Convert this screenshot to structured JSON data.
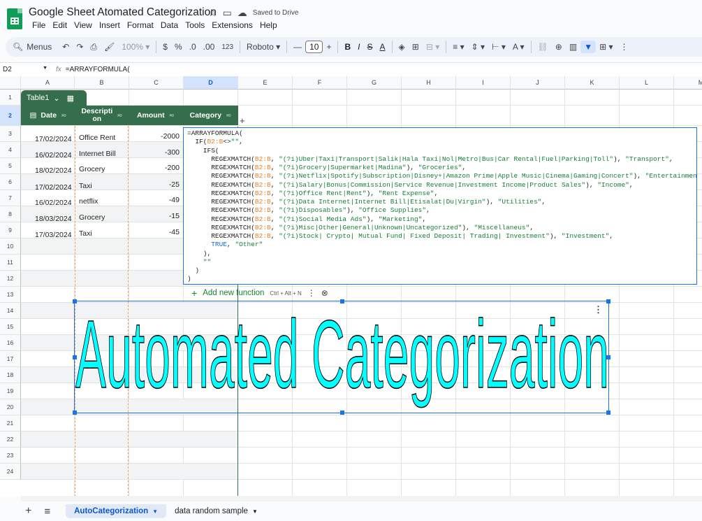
{
  "app": {
    "doc_title": "Google Sheet Atomated Categorization",
    "saved_status": "Saved to Drive",
    "menu": [
      "File",
      "Edit",
      "View",
      "Insert",
      "Format",
      "Data",
      "Tools",
      "Extensions",
      "Help"
    ]
  },
  "toolbar": {
    "menus_label": "Menus",
    "zoom": "100%",
    "currency": "$",
    "percent": "%",
    "dec_decrease": ".0",
    "dec_increase": ".00",
    "more_formats": "123",
    "font": "Roboto",
    "font_size": "10",
    "minus": "—",
    "plus": "+",
    "bold": "B",
    "italic": "I",
    "strike": "S",
    "underline": "A"
  },
  "formula_bar": {
    "cell_ref": "D2",
    "fx": "fx",
    "formula": "=ARRAYFORMULA("
  },
  "columns": [
    "A",
    "B",
    "C",
    "D",
    "E",
    "F",
    "G",
    "H",
    "I",
    "J",
    "K",
    "L",
    "M"
  ],
  "rows": [
    "1",
    "2",
    "3",
    "4",
    "5",
    "6",
    "7",
    "8",
    "9",
    "10",
    "11",
    "12",
    "13",
    "14",
    "15",
    "16",
    "17",
    "18",
    "19",
    "20",
    "21",
    "22",
    "23",
    "24"
  ],
  "table": {
    "name": "Table1",
    "headers": {
      "date": "Date",
      "description_line1": "Descripti",
      "description_line2": "on",
      "amount": "Amount",
      "category": "Category"
    },
    "add_column": "+",
    "rows": [
      {
        "date": "17/02/2024",
        "description": "Office Rent",
        "amount": "-2000"
      },
      {
        "date": "16/02/2024",
        "description": "Internet Bill",
        "amount": "-300"
      },
      {
        "date": "18/02/2024",
        "description": "Grocery",
        "amount": "-200"
      },
      {
        "date": "17/02/2024",
        "description": "Taxi",
        "amount": "-25"
      },
      {
        "date": "16/02/2024",
        "description": "netflix",
        "amount": "-49"
      },
      {
        "date": "18/03/2024",
        "description": "Grocery",
        "amount": "-15"
      },
      {
        "date": "17/03/2024",
        "description": "Taxi",
        "amount": "-45"
      }
    ]
  },
  "editor": {
    "lines": [
      [
        {
          "t": "=ARRAYFORMULA("
        }
      ],
      [
        {
          "t": "  IF("
        },
        {
          "t": "B2:B",
          "c": "ref"
        },
        {
          "t": "<>"
        },
        {
          "t": "\"\"",
          "c": "str"
        },
        {
          "t": ","
        }
      ],
      [
        {
          "t": "    IFS("
        }
      ],
      [
        {
          "t": "      REGEXMATCH("
        },
        {
          "t": "B2:B",
          "c": "ref"
        },
        {
          "t": ", "
        },
        {
          "t": "\"(?i)Uber|Taxi|Transport|Salik|Hala Taxi|Nol|Metro|Bus|Car Rental|Fuel|Parking|Toll\"",
          "c": "str"
        },
        {
          "t": "), "
        },
        {
          "t": "\"Transport\"",
          "c": "str"
        },
        {
          "t": ","
        }
      ],
      [
        {
          "t": "      REGEXMATCH("
        },
        {
          "t": "B2:B",
          "c": "ref"
        },
        {
          "t": ", "
        },
        {
          "t": "\"(?i)Grocery|Supermarket|Madina\"",
          "c": "str"
        },
        {
          "t": "), "
        },
        {
          "t": "\"Groceries\"",
          "c": "str"
        },
        {
          "t": ","
        }
      ],
      [
        {
          "t": "      REGEXMATCH("
        },
        {
          "t": "B2:B",
          "c": "ref"
        },
        {
          "t": ", "
        },
        {
          "t": "\"(?i)Netflix|Spotify|Subscription|Disney+|Amazon Prime|Apple Music|Cinema|Gaming|Concert\"",
          "c": "str"
        },
        {
          "t": "), "
        },
        {
          "t": "\"Entertainment\"",
          "c": "str"
        },
        {
          "t": ","
        }
      ],
      [
        {
          "t": "      REGEXMATCH("
        },
        {
          "t": "B2:B",
          "c": "ref"
        },
        {
          "t": ", "
        },
        {
          "t": "\"(?i)Salary|Bonus|Commission|Service Revenue|Investment Income|Product Sales\"",
          "c": "str"
        },
        {
          "t": "), "
        },
        {
          "t": "\"Income\"",
          "c": "str"
        },
        {
          "t": ","
        }
      ],
      [
        {
          "t": "      REGEXMATCH("
        },
        {
          "t": "B2:B",
          "c": "ref"
        },
        {
          "t": ", "
        },
        {
          "t": "\"(?i)Office Rent|Rent\"",
          "c": "str"
        },
        {
          "t": "), "
        },
        {
          "t": "\"Rent Expense\"",
          "c": "str"
        },
        {
          "t": ","
        }
      ],
      [
        {
          "t": "      REGEXMATCH("
        },
        {
          "t": "B2:B",
          "c": "ref"
        },
        {
          "t": ", "
        },
        {
          "t": "\"(?i)Data Internet|Internet Bill|Etisalat|Du|Virgin\"",
          "c": "str"
        },
        {
          "t": "), "
        },
        {
          "t": "\"Utilities\"",
          "c": "str"
        },
        {
          "t": ","
        }
      ],
      [
        {
          "t": "      REGEXMATCH("
        },
        {
          "t": "B2:B",
          "c": "ref"
        },
        {
          "t": ", "
        },
        {
          "t": "\"(?i)Disposables\"",
          "c": "str"
        },
        {
          "t": "), "
        },
        {
          "t": "\"Office Supplies\"",
          "c": "str"
        },
        {
          "t": ","
        }
      ],
      [
        {
          "t": "      REGEXMATCH("
        },
        {
          "t": "B2:B",
          "c": "ref"
        },
        {
          "t": ", "
        },
        {
          "t": "\"(?i)Social Media Ads\"",
          "c": "str"
        },
        {
          "t": "), "
        },
        {
          "t": "\"Marketing\"",
          "c": "str"
        },
        {
          "t": ","
        }
      ],
      [
        {
          "t": "      REGEXMATCH("
        },
        {
          "t": "B2:B",
          "c": "ref"
        },
        {
          "t": ", "
        },
        {
          "t": "\"(?i)Misc|Other|General|Unknown|Uncategorized\"",
          "c": "str"
        },
        {
          "t": "), "
        },
        {
          "t": "\"Miscellaneus\"",
          "c": "str"
        },
        {
          "t": ","
        }
      ],
      [
        {
          "t": "      REGEXMATCH("
        },
        {
          "t": "B2:B",
          "c": "ref"
        },
        {
          "t": ", "
        },
        {
          "t": "\"(?i)Stock| Crypto| Mutual Fund| Fixed Deposit| Trading| Investment\"",
          "c": "str"
        },
        {
          "t": "), "
        },
        {
          "t": "\"Investment\"",
          "c": "str"
        },
        {
          "t": ","
        }
      ],
      [
        {
          "t": "      "
        },
        {
          "t": "TRUE",
          "c": "bool"
        },
        {
          "t": ", "
        },
        {
          "t": "\"Other\"",
          "c": "str"
        }
      ],
      [
        {
          "t": "    ),"
        }
      ],
      [
        {
          "t": "    "
        },
        {
          "t": "\"\"",
          "c": "str"
        }
      ],
      [
        {
          "t": "  )"
        }
      ],
      [
        {
          "t": ")"
        }
      ]
    ],
    "add_function_label": "Add new function",
    "add_function_shortcut": "Ctrl + Alt + N"
  },
  "drawing": {
    "text": "Automated Categorization",
    "fill_color": "#00ffff",
    "stroke_color": "#000000"
  },
  "sheet_tabs": {
    "add": "+",
    "list": "≡",
    "tabs": [
      "AutoCategorization",
      "data random sample"
    ]
  },
  "colors": {
    "table_header": "#356e4c",
    "selection": "#1a73e8",
    "accent": "#0b57d0"
  }
}
